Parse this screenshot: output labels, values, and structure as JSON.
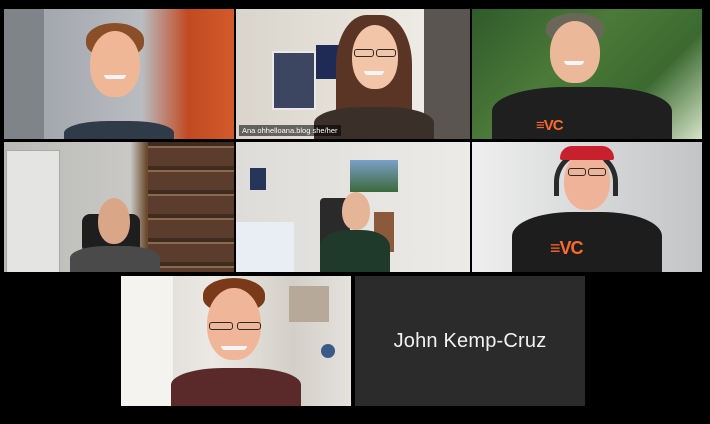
{
  "app": "video-call-gallery-view",
  "participants": [
    {
      "id": 1,
      "label": ""
    },
    {
      "id": 2,
      "label": "Ana ohhelloana.blog she/her",
      "active_speaker": true
    },
    {
      "id": 3,
      "label": ""
    },
    {
      "id": 4,
      "label": ""
    },
    {
      "id": 5,
      "label": ""
    },
    {
      "id": 6,
      "label": ""
    },
    {
      "id": 7,
      "label": ""
    },
    {
      "id": 8,
      "label": "John Kemp-Cruz",
      "video_off": true
    }
  ],
  "colors": {
    "background": "#000000",
    "active_speaker_border": "#dcd87a",
    "video_off_tile": "#2b2b2b",
    "shirt_logo": "#ff6a2a"
  }
}
